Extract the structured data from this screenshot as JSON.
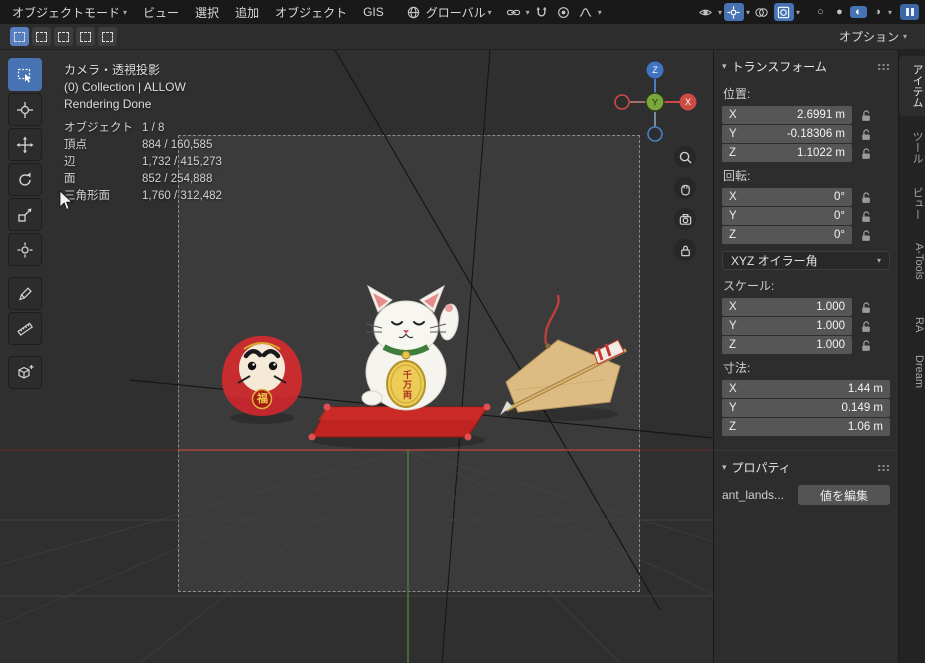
{
  "topbar": {
    "menus": [
      "オブジェクトモード",
      "ビュー",
      "選択",
      "追加",
      "オブジェクト",
      "GIS"
    ],
    "orientation": "グローバル"
  },
  "toolsettings": {
    "options_label": "オプション"
  },
  "viewport": {
    "header_lines": [
      "カメラ・透視投影",
      "(0) Collection | ALLOW",
      "Rendering Done"
    ],
    "stats": [
      {
        "label": "オブジェクト",
        "value": "1 / 8"
      },
      {
        "label": "頂点",
        "value": "884 / 160,585"
      },
      {
        "label": "辺",
        "value": "1,732 / 415,273"
      },
      {
        "label": "面",
        "value": "852 / 254,888"
      },
      {
        "label": "三角形面",
        "value": "1,760 / 312,482"
      }
    ],
    "gizmo": {
      "x": "X",
      "y": "Y",
      "z": "Z"
    }
  },
  "scene": {
    "daruma_text": "福",
    "coin_text": "千万両"
  },
  "sidebar": {
    "transform_title": "トランスフォーム",
    "location": {
      "label": "位置:",
      "rows": [
        {
          "axis": "X",
          "value": "2.6991 m"
        },
        {
          "axis": "Y",
          "value": "-0.18306 m"
        },
        {
          "axis": "Z",
          "value": "1.1022 m"
        }
      ]
    },
    "rotation": {
      "label": "回転:",
      "rows": [
        {
          "axis": "X",
          "value": "0°"
        },
        {
          "axis": "Y",
          "value": "0°"
        },
        {
          "axis": "Z",
          "value": "0°"
        }
      ]
    },
    "rotation_mode": "XYZ オイラー角",
    "scale": {
      "label": "スケール:",
      "rows": [
        {
          "axis": "X",
          "value": "1.000"
        },
        {
          "axis": "Y",
          "value": "1.000"
        },
        {
          "axis": "Z",
          "value": "1.000"
        }
      ]
    },
    "dimensions": {
      "label": "寸法:",
      "rows": [
        {
          "axis": "X",
          "value": "1.44 m"
        },
        {
          "axis": "Y",
          "value": "0.149 m"
        },
        {
          "axis": "Z",
          "value": "1.06 m"
        }
      ]
    },
    "properties_title": "プロパティ",
    "property_name": "ant_lands...",
    "edit_button": "値を編集"
  },
  "tabs": [
    "アイテム",
    "ツール",
    "ビュー",
    "A-Tools",
    "RA",
    "Dream"
  ]
}
